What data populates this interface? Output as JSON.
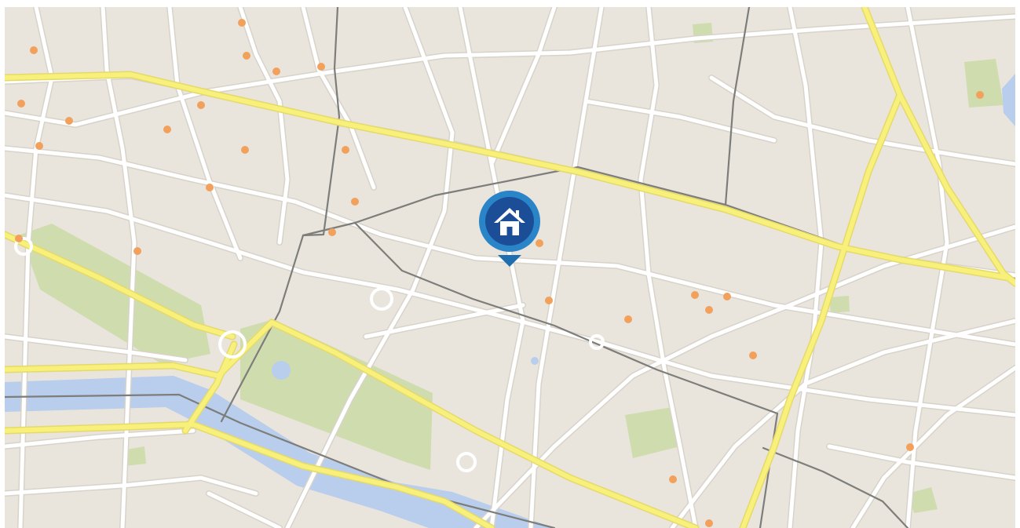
{
  "map": {
    "colors": {
      "land": "#e9e5dd",
      "street": "#ffffff",
      "street_casing": "#d8d3ca",
      "major_road": "#f7f07a",
      "major_road_casing": "#e6d96a",
      "transit_line": "#7d7d7a",
      "water": "#b9cdec",
      "park": "#cfdcae",
      "poi": "#f2a15c",
      "marker": "#1f6fb0"
    },
    "home_marker": {
      "icon": "home-icon"
    },
    "poi_icon": "poi-dot-icon"
  }
}
